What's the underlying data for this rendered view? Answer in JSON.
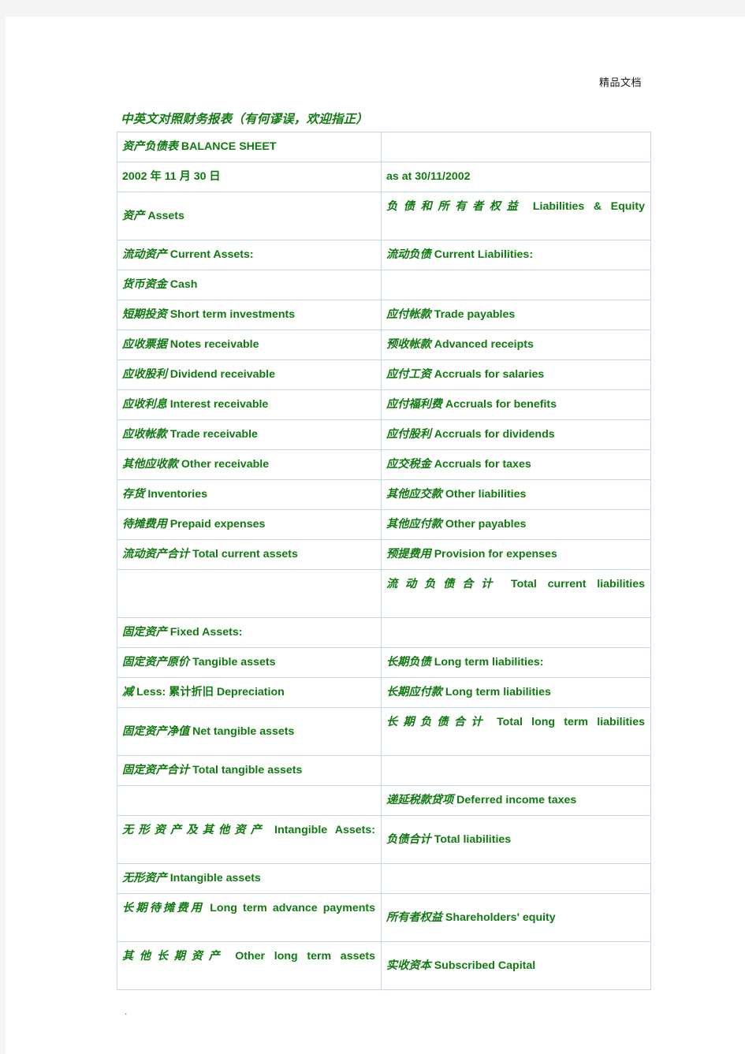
{
  "page": {
    "watermark": "精品文档",
    "doc_title": "中英文对照财务报表（有何谬误，欢迎指正）",
    "footer_mark": ".",
    "accent_green": "#0f7a10",
    "border_color": "#c7d5e8",
    "page_background": "#ffffff",
    "canvas_background": "#f4f4f4"
  },
  "table": {
    "name": "balance-sheet-table",
    "columns": [
      "assets",
      "liabilities-and-equity"
    ],
    "rows": [
      {
        "left": "资产负债表 BALANCE SHEET",
        "right": "",
        "left_lines": 1,
        "right_lines": 1
      },
      {
        "left": "2002 年 11 月 30 日",
        "right": "as at 30/11/2002",
        "left_lines": 1,
        "right_lines": 1
      },
      {
        "left": "资产 Assets",
        "right": "负债和所有者权益 Liabilities & Equity",
        "left_lines": 1,
        "right_lines": 2
      },
      {
        "left": "流动资产 Current Assets:",
        "right": "流动负债 Current Liabilities:",
        "left_lines": 1,
        "right_lines": 1
      },
      {
        "left": "货币资金 Cash",
        "right": "",
        "left_lines": 1,
        "right_lines": 1
      },
      {
        "left": "短期投资 Short term investments",
        "right": "应付帐款 Trade payables",
        "left_lines": 1,
        "right_lines": 1
      },
      {
        "left": "应收票据 Notes receivable",
        "right": "预收帐款 Advanced receipts",
        "left_lines": 1,
        "right_lines": 1
      },
      {
        "left": "应收股利 Dividend receivable",
        "right": "应付工资 Accruals for salaries",
        "left_lines": 1,
        "right_lines": 1
      },
      {
        "left": "应收利息 Interest receivable",
        "right": "应付福利费 Accruals for benefits",
        "left_lines": 1,
        "right_lines": 1
      },
      {
        "left": "应收帐款 Trade receivable",
        "right": "应付股利 Accruals for dividends",
        "left_lines": 1,
        "right_lines": 1
      },
      {
        "left": "其他应收款 Other receivable",
        "right": "应交税金 Accruals for taxes",
        "left_lines": 1,
        "right_lines": 1
      },
      {
        "left": "存货 Inventories",
        "right": "其他应交款 Other liabilities",
        "left_lines": 1,
        "right_lines": 1
      },
      {
        "left": "待摊费用 Prepaid expenses",
        "right": "其他应付款 Other payables",
        "left_lines": 1,
        "right_lines": 1
      },
      {
        "left": "流动资产合计 Total current assets",
        "right": "预提费用 Provision for expenses",
        "left_lines": 1,
        "right_lines": 1
      },
      {
        "left": "",
        "right": "流动负债合计 Total current liabilities",
        "left_lines": 1,
        "right_lines": 2
      },
      {
        "left": "固定资产 Fixed Assets:",
        "right": "",
        "left_lines": 1,
        "right_lines": 1
      },
      {
        "left": "固定资产原价 Tangible assets",
        "right": "长期负债 Long term liabilities:",
        "left_lines": 1,
        "right_lines": 1
      },
      {
        "left": "减 Less: 累计折旧 Depreciation",
        "right": "长期应付款 Long term liabilities",
        "left_lines": 1,
        "right_lines": 1
      },
      {
        "left": "固定资产净值 Net tangible assets",
        "right": "长期负债合计 Total long term liabilities",
        "left_lines": 1,
        "right_lines": 2
      },
      {
        "left": "固定资产合计 Total tangible assets",
        "right": "",
        "left_lines": 1,
        "right_lines": 1
      },
      {
        "left": "",
        "right": "递延税款贷项 Deferred income taxes",
        "left_lines": 1,
        "right_lines": 1
      },
      {
        "left": "无形资产及其他资产 Intangible Assets:",
        "right": "负债合计 Total liabilities",
        "left_lines": 2,
        "right_lines": 1
      },
      {
        "left": "无形资产 Intangible assets",
        "right": "",
        "left_lines": 1,
        "right_lines": 1
      },
      {
        "left": "长期待摊费用 Long term advance payments",
        "right": "所有者权益 Shareholders' equity",
        "left_lines": 2,
        "right_lines": 1
      },
      {
        "left": "其他长期资产 Other long term assets",
        "right": "实收资本 Subscribed Capital",
        "left_lines": 2,
        "right_lines": 1
      }
    ]
  }
}
